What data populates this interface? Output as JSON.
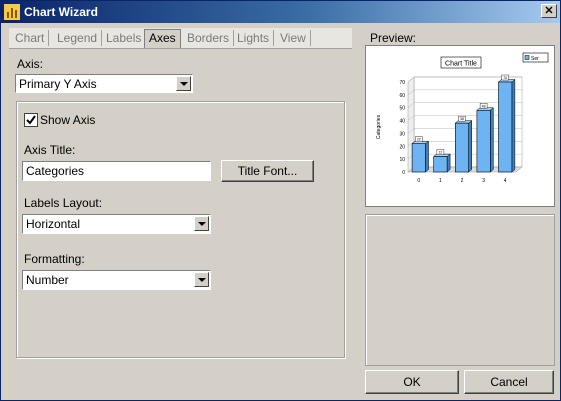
{
  "window": {
    "title": "Chart Wizard",
    "close_glyph": "✕"
  },
  "tabs": [
    {
      "label": "Chart",
      "active": false
    },
    {
      "label": "Legend",
      "active": false
    },
    {
      "label": "Labels",
      "active": false
    },
    {
      "label": "Axes",
      "active": true
    },
    {
      "label": "Borders",
      "active": false
    },
    {
      "label": "Lights",
      "active": false
    },
    {
      "label": "View",
      "active": false
    }
  ],
  "axes": {
    "axis_label": "Axis:",
    "axis_value": "Primary Y Axis",
    "show_axis_label": "Show Axis",
    "show_axis_checked": true,
    "axis_title_label": "Axis Title:",
    "axis_title_value": "Categories",
    "title_font_button": "Title Font...",
    "labels_layout_label": "Labels Layout:",
    "labels_layout_value": "Horizontal",
    "formatting_label": "Formatting:",
    "formatting_value": "Number"
  },
  "preview": {
    "label": "Preview:",
    "chart_data": {
      "type": "bar",
      "title": "Chart Title",
      "ylabel": "Categories",
      "categories": [
        "0",
        "1",
        "2",
        "3",
        "4"
      ],
      "values": [
        22,
        12,
        38,
        48,
        70
      ],
      "yticks": [
        "0",
        "10",
        "20",
        "30",
        "40",
        "50",
        "60",
        "70"
      ],
      "ylim": [
        0,
        70
      ],
      "legend": "Ser",
      "legend_position": "top-right",
      "bar_color": "#6fb4f2"
    }
  },
  "buttons": {
    "ok": "OK",
    "cancel": "Cancel"
  }
}
